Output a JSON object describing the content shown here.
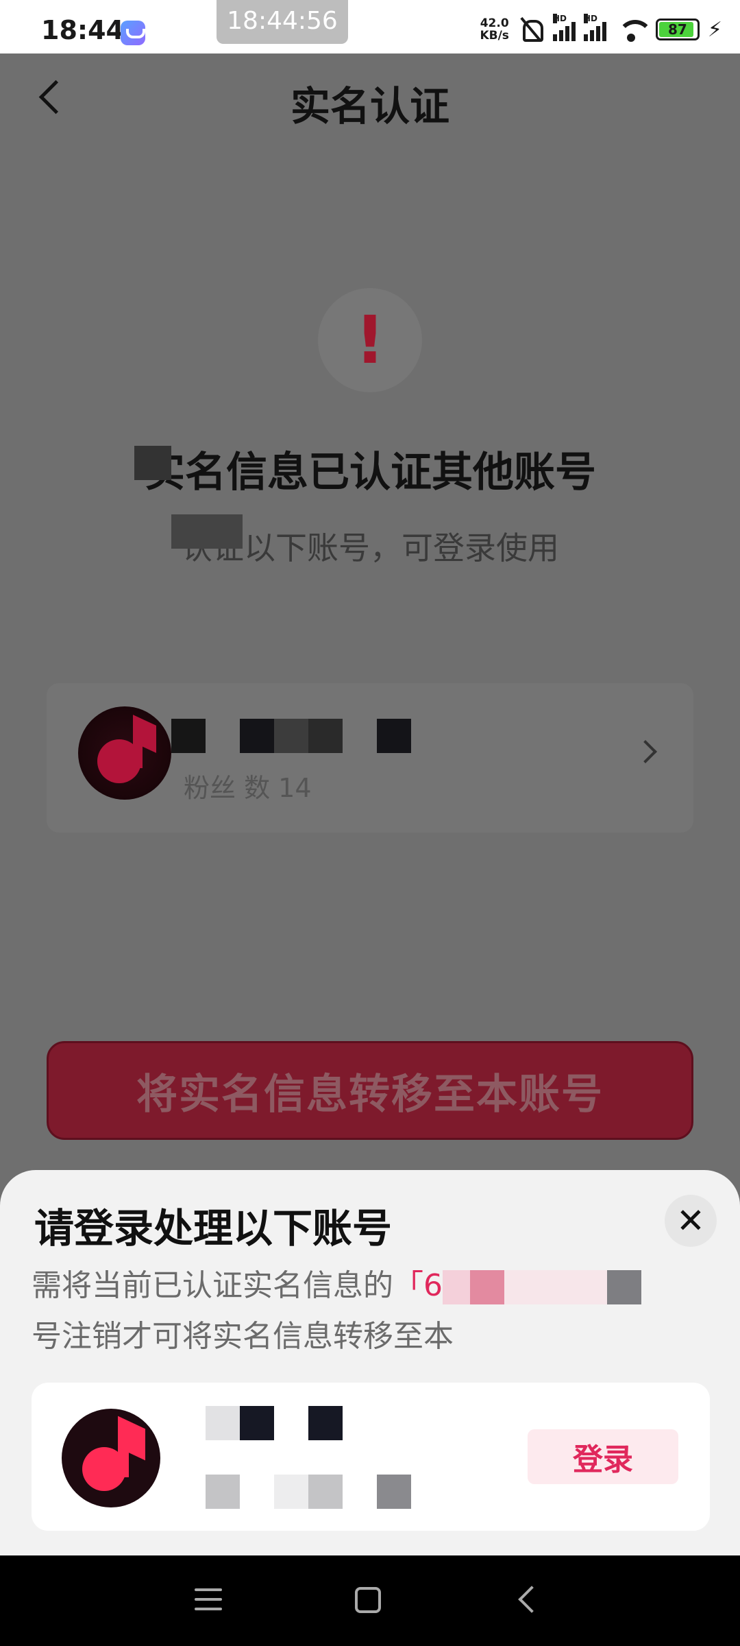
{
  "status_bar": {
    "time": "18:44",
    "clock_pill": "18:44:56",
    "net_speed_value": "42.0",
    "net_speed_unit": "KB/s",
    "hd_label": "HD",
    "battery_level": "87",
    "bolt": "⚡"
  },
  "header": {
    "title": "实名认证"
  },
  "notice": {
    "icon_glyph": "!",
    "headline": "实名信息已认证其他账号",
    "subtext": "认证以下账号，可登录使用"
  },
  "account_card": {
    "fans_text": "粉丝          数 14"
  },
  "actions": {
    "transfer_label": "将实名信息转移至本账号"
  },
  "sheet": {
    "title": "请登录处理以下账号",
    "close_glyph": "✕",
    "desc_prefix": "需将当前已认证实名信息的",
    "desc_highlight": "「6",
    "desc_suffix": "号注销才可将实名信息转移至本",
    "login_label": "登录"
  },
  "colors": {
    "accent": "#e0285c",
    "dim_overlay": "#6f6f6f",
    "button_dim": "#7e1a2c"
  }
}
